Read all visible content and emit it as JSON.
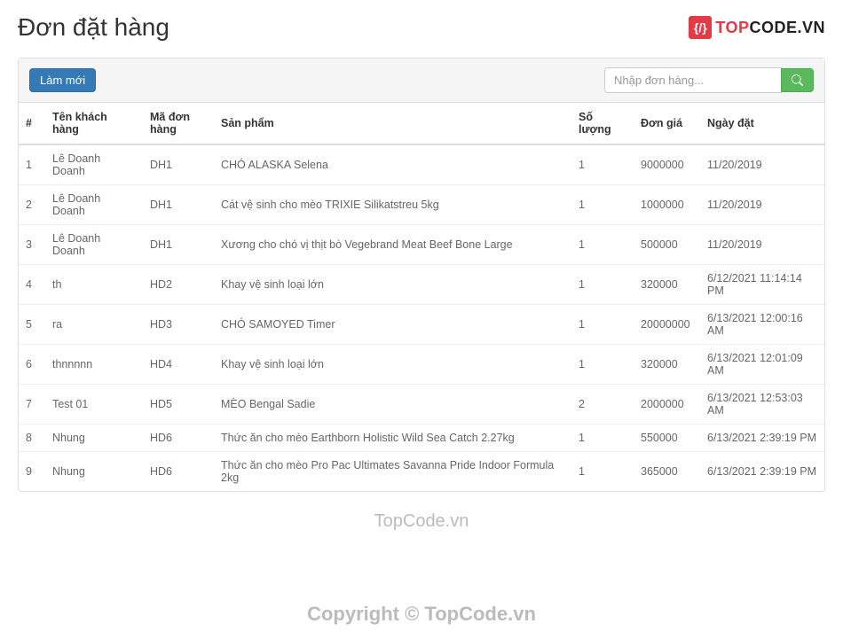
{
  "header": {
    "title": "Đơn đặt hàng",
    "logo_top": "TOP",
    "logo_code": "CODE.VN"
  },
  "toolbar": {
    "refresh_label": "Làm mới",
    "search_placeholder": "Nhập đơn hàng..."
  },
  "table": {
    "headers": {
      "idx": "#",
      "customer": "Tên khách hàng",
      "order_code": "Mã đơn hàng",
      "product": "Sản phẩm",
      "qty": "Số lượng",
      "price": "Đơn giá",
      "date": "Ngày đặt"
    },
    "rows": [
      {
        "idx": "1",
        "customer": "Lê Doanh Doanh",
        "code": "DH1",
        "product": "CHÓ ALASKA Selena",
        "qty": "1",
        "price": "9000000",
        "date": "11/20/2019"
      },
      {
        "idx": "2",
        "customer": "Lê Doanh Doanh",
        "code": "DH1",
        "product": "Cát vệ sinh cho mèo TRIXIE Silikatstreu 5kg",
        "qty": "1",
        "price": "1000000",
        "date": "11/20/2019"
      },
      {
        "idx": "3",
        "customer": "Lê Doanh Doanh",
        "code": "DH1",
        "product": "Xương cho chó vị thịt bò Vegebrand Meat Beef Bone Large",
        "qty": "1",
        "price": "500000",
        "date": "11/20/2019"
      },
      {
        "idx": "4",
        "customer": "th",
        "code": "HD2",
        "product": "Khay vệ sinh loại lớn",
        "qty": "1",
        "price": "320000",
        "date": "6/12/2021 11:14:14 PM"
      },
      {
        "idx": "5",
        "customer": "ra",
        "code": "HD3",
        "product": "CHÓ SAMOYED Timer",
        "qty": "1",
        "price": "20000000",
        "date": "6/13/2021 12:00:16 AM"
      },
      {
        "idx": "6",
        "customer": "thnnnnn",
        "code": "HD4",
        "product": "Khay vệ sinh loại lớn",
        "qty": "1",
        "price": "320000",
        "date": "6/13/2021 12:01:09 AM"
      },
      {
        "idx": "7",
        "customer": "Test 01",
        "code": "HD5",
        "product": "MÈO Bengal Sadie",
        "qty": "2",
        "price": "2000000",
        "date": "6/13/2021 12:53:03 AM"
      },
      {
        "idx": "8",
        "customer": "Nhung",
        "code": "HD6",
        "product": "Thức ăn cho mèo Earthborn Holistic Wild Sea Catch 2.27kg",
        "qty": "1",
        "price": "550000",
        "date": "6/13/2021 2:39:19 PM"
      },
      {
        "idx": "9",
        "customer": "Nhung",
        "code": "HD6",
        "product": "Thức ăn cho mèo Pro Pac Ultimates Savanna Pride Indoor Formula 2kg",
        "qty": "1",
        "price": "365000",
        "date": "6/13/2021 2:39:19 PM"
      }
    ]
  },
  "watermark": {
    "line1": "TopCode.vn",
    "line2": "Copyright © TopCode.vn"
  }
}
